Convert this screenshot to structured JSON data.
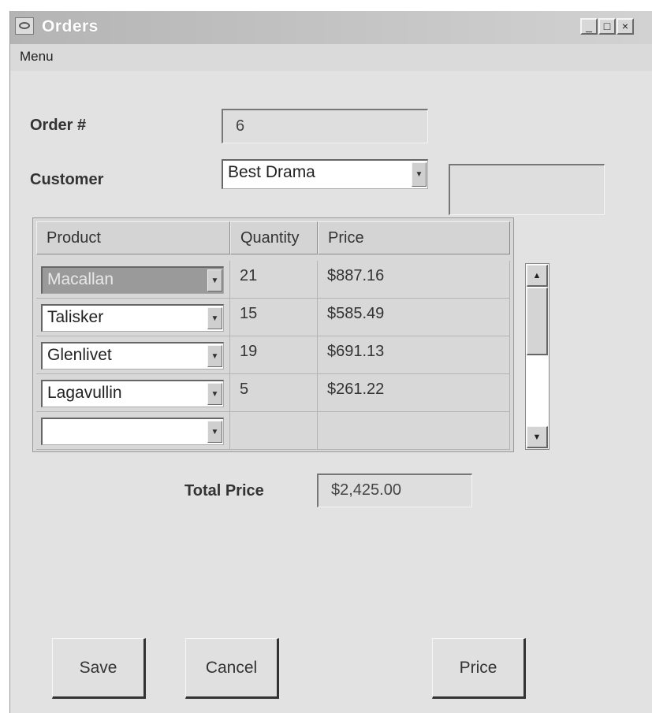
{
  "window": {
    "title": "Orders",
    "controls": {
      "minimize": "_",
      "maximize": "□",
      "close": "×"
    }
  },
  "menubar": {
    "menu_label": "Menu"
  },
  "form": {
    "order_label": "Order #",
    "order_value": "6",
    "customer_label": "Customer",
    "customer_value": "Best Drama",
    "customer_extra_value": ""
  },
  "table": {
    "columns": [
      "Product",
      "Quantity",
      "Price"
    ],
    "rows": [
      {
        "product": "Macallan",
        "quantity": "21",
        "price": "$887.16",
        "selected": true
      },
      {
        "product": "Talisker",
        "quantity": "15",
        "price": "$585.49"
      },
      {
        "product": "Glenlivet",
        "quantity": "19",
        "price": "$691.13"
      },
      {
        "product": "Lagavullin",
        "quantity": "5",
        "price": "$261.22"
      },
      {
        "product": "",
        "quantity": "",
        "price": ""
      }
    ]
  },
  "total": {
    "label": "Total Price",
    "value": "$2,425.00"
  },
  "buttons": {
    "save": "Save",
    "cancel": "Cancel",
    "price": "Price"
  },
  "icons": {
    "app": "app-window-icon",
    "dropdown": "chevron-down-icon",
    "scroll_up": "arrow-up-icon",
    "scroll_down": "arrow-down-icon"
  }
}
